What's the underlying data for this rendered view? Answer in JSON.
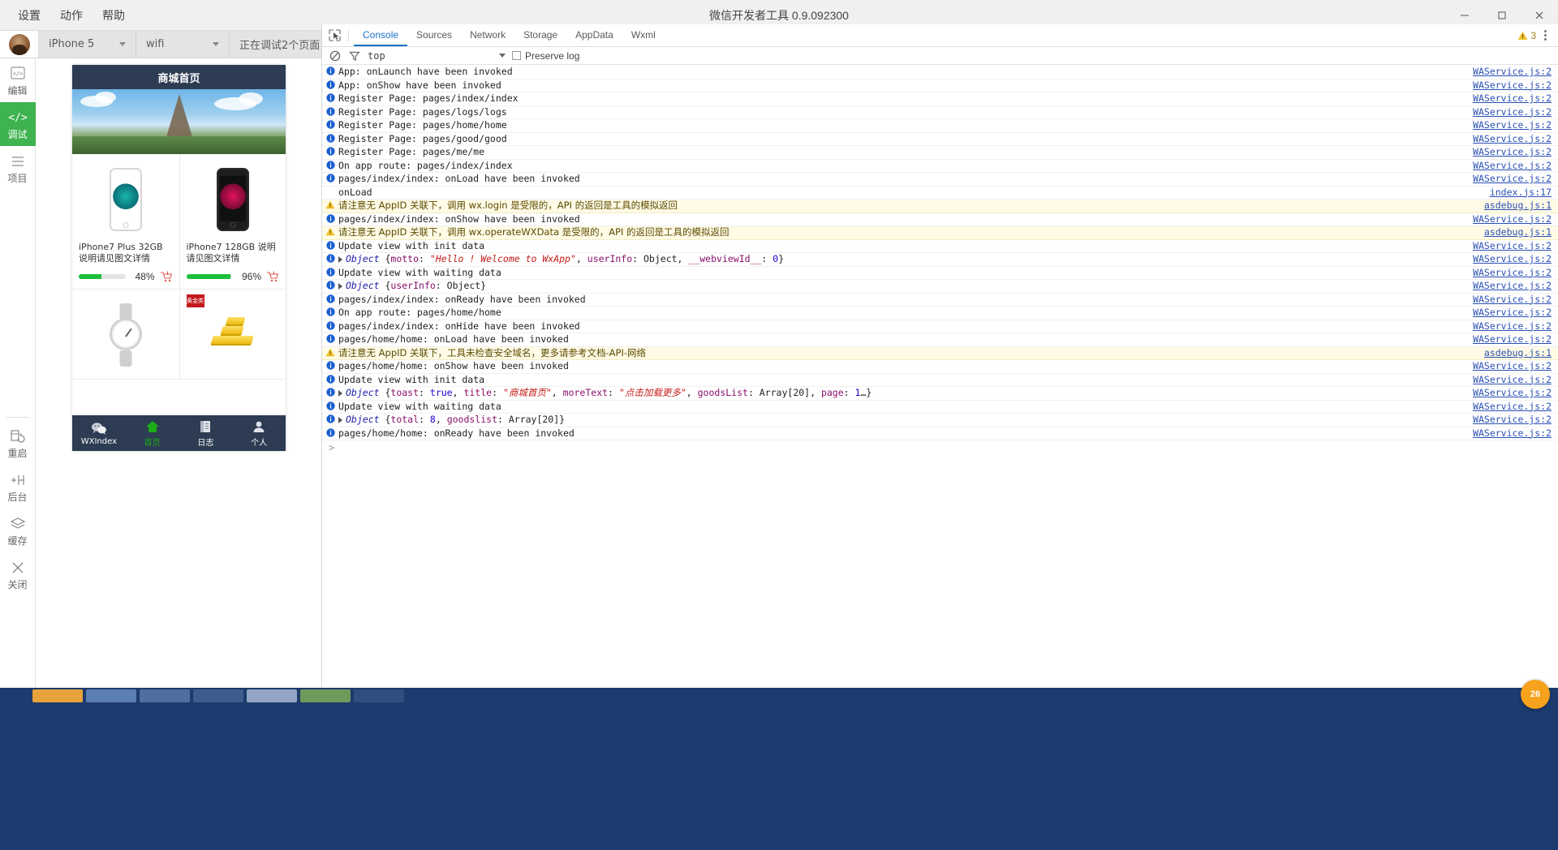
{
  "window": {
    "title": "微信开发者工具 0.9.092300",
    "minimize": "—",
    "maximize": "▢",
    "close": "✕"
  },
  "menu": [
    {
      "label": "设置",
      "name": "menu-settings"
    },
    {
      "label": "动作",
      "name": "menu-actions"
    },
    {
      "label": "帮助",
      "name": "menu-help"
    }
  ],
  "toolbar": {
    "device": "iPhone 5",
    "network": "wifi",
    "debug_target": "正在调试2个页面"
  },
  "sidebar": {
    "items": [
      {
        "label": "编辑",
        "icon": "code-edit-icon"
      },
      {
        "label": "调试",
        "icon": "code-debug-icon"
      },
      {
        "label": "项目",
        "icon": "list-project-icon"
      }
    ],
    "actions": [
      {
        "label": "重启",
        "icon": "restart-icon"
      },
      {
        "label": "后台",
        "icon": "background-icon"
      },
      {
        "label": "缓存",
        "icon": "cache-icon"
      },
      {
        "label": "关闭",
        "icon": "close-x-icon"
      }
    ]
  },
  "simulator": {
    "nav_title": "商城首页",
    "products": [
      {
        "title": "iPhone7 Plus 32GB 说明请见图文详情",
        "percent": "48%",
        "progress": 48,
        "image": "iphone-silver"
      },
      {
        "title": "iPhone7 128GB 说明请见图文详情",
        "percent": "96%",
        "progress": 96,
        "image": "iphone-black"
      },
      {
        "title": "",
        "percent": "",
        "progress": 0,
        "image": "wristwatch"
      },
      {
        "title": "",
        "percent": "",
        "progress": 0,
        "image": "gold-bars",
        "tag": "黄金类"
      }
    ],
    "tabs": [
      {
        "label": "WXIndex",
        "icon": "wechat-icon",
        "active": false
      },
      {
        "label": "首页",
        "icon": "home-icon",
        "active": true
      },
      {
        "label": "日志",
        "icon": "log-book-icon",
        "active": false
      },
      {
        "label": "个人",
        "icon": "person-icon",
        "active": false
      }
    ]
  },
  "devtools": {
    "tabs": [
      {
        "label": "Console",
        "active": true
      },
      {
        "label": "Sources",
        "active": false
      },
      {
        "label": "Network",
        "active": false
      },
      {
        "label": "Storage",
        "active": false
      },
      {
        "label": "AppData",
        "active": false
      },
      {
        "label": "Wxml",
        "active": false
      }
    ],
    "warning_count": "3",
    "filter": {
      "context": "top",
      "preserve_log_label": "Preserve log",
      "preserve_log_checked": false
    },
    "prompt": ">",
    "logs": [
      {
        "level": "info",
        "text": "App: onLaunch have been invoked",
        "source": "WAService.js:2"
      },
      {
        "level": "info",
        "text": "App: onShow have been invoked",
        "source": "WAService.js:2"
      },
      {
        "level": "info",
        "text": "Register Page: pages/index/index",
        "source": "WAService.js:2"
      },
      {
        "level": "info",
        "text": "Register Page: pages/logs/logs",
        "source": "WAService.js:2"
      },
      {
        "level": "info",
        "text": "Register Page: pages/home/home",
        "source": "WAService.js:2"
      },
      {
        "level": "info",
        "text": "Register Page: pages/good/good",
        "source": "WAService.js:2"
      },
      {
        "level": "info",
        "text": "Register Page: pages/me/me",
        "source": "WAService.js:2"
      },
      {
        "level": "info",
        "text": "On app route: pages/index/index",
        "source": "WAService.js:2"
      },
      {
        "level": "info",
        "text": "pages/index/index: onLoad have been invoked",
        "source": "WAService.js:2"
      },
      {
        "level": "plain",
        "text": "onLoad",
        "source": "index.js:17"
      },
      {
        "level": "warn",
        "text": "请注意无 AppID 关联下，调用 wx.login 是受限的，API 的返回是工具的模拟返回",
        "source": "asdebug.js:1"
      },
      {
        "level": "info",
        "text": "pages/index/index: onShow have been invoked",
        "source": "WAService.js:2"
      },
      {
        "level": "warn",
        "text": "请注意无 AppID 关联下，调用 wx.operateWXData 是受限的，API 的返回是工具的模拟返回",
        "source": "asdebug.js:1"
      },
      {
        "level": "info",
        "text": "Update view with init data",
        "source": "WAService.js:2"
      },
      {
        "level": "object",
        "object_kind": "motto",
        "text": "Object {motto: \"Hello ! Welcome to WxApp\", userInfo: Object, __webviewId__: 0}",
        "source": "WAService.js:2"
      },
      {
        "level": "info",
        "text": "Update view with waiting data",
        "source": "WAService.js:2"
      },
      {
        "level": "object",
        "object_kind": "userinfo",
        "text": "Object {userInfo: Object}",
        "source": "WAService.js:2"
      },
      {
        "level": "info",
        "text": "pages/index/index: onReady have been invoked",
        "source": "WAService.js:2"
      },
      {
        "level": "info",
        "text": "On app route: pages/home/home",
        "source": "WAService.js:2"
      },
      {
        "level": "info",
        "text": "pages/index/index: onHide have been invoked",
        "source": "WAService.js:2"
      },
      {
        "level": "info",
        "text": "pages/home/home: onLoad have been invoked",
        "source": "WAService.js:2"
      },
      {
        "level": "warn",
        "text": "请注意无 AppID 关联下，工具未检查安全域名，更多请参考文档-API-网络",
        "source": "asdebug.js:1"
      },
      {
        "level": "info",
        "text": "pages/home/home: onShow have been invoked",
        "source": "WAService.js:2"
      },
      {
        "level": "info",
        "text": "Update view with init data",
        "source": "WAService.js:2"
      },
      {
        "level": "object",
        "object_kind": "toast",
        "text": "Object {toast: true, title: \"商城首页\", moreText: \"点击加载更多\", goodsList: Array[20], page: 1…}",
        "source": "WAService.js:2"
      },
      {
        "level": "info",
        "text": "Update view with waiting data",
        "source": "WAService.js:2"
      },
      {
        "level": "object",
        "object_kind": "total",
        "text": "Object {total: 8, goodslist: Array[20]}",
        "source": "WAService.js:2"
      },
      {
        "level": "info",
        "text": "pages/home/home: onReady have been invoked",
        "source": "WAService.js:2"
      }
    ]
  },
  "taskbar": {
    "badge": "26"
  },
  "colors": {
    "accent_green": "#3eb34f",
    "devtools_blue": "#1a73c7",
    "warn_bg": "#fffbe6",
    "navbar": "#2d3c52"
  }
}
